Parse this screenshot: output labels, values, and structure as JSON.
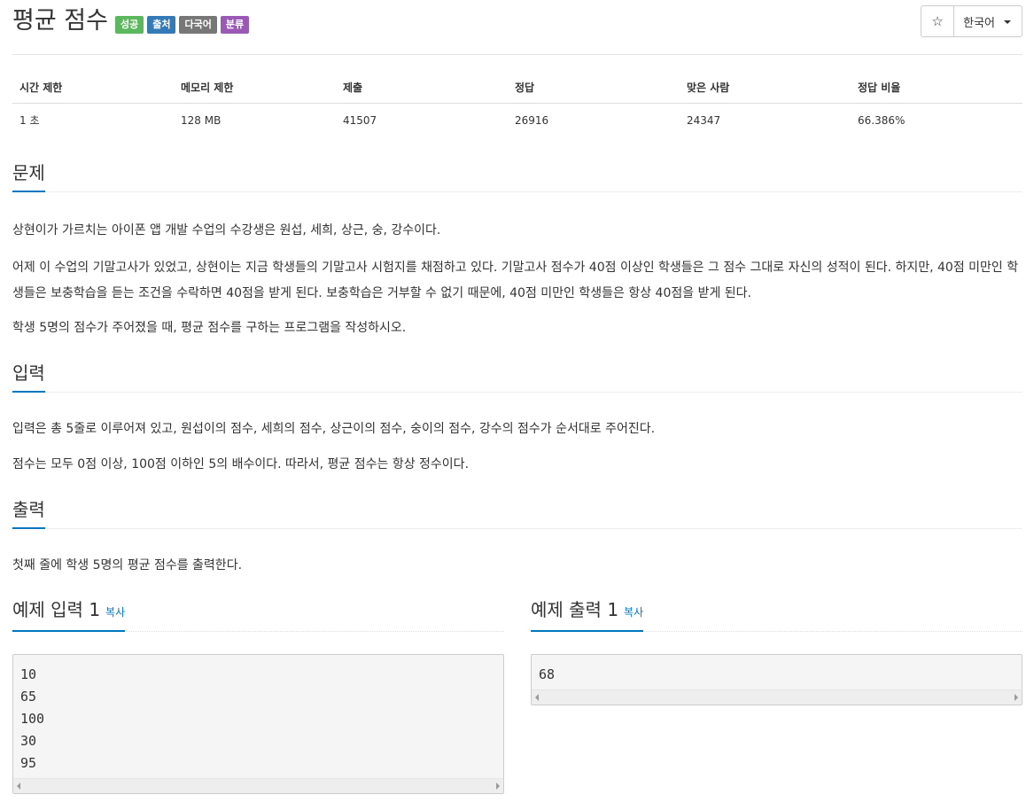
{
  "header": {
    "title": "평균 점수",
    "badges": [
      {
        "label": "성공",
        "color": "#5cb85c"
      },
      {
        "label": "출처",
        "color": "#337ab7"
      },
      {
        "label": "다국어",
        "color": "#777777"
      },
      {
        "label": "분류",
        "color": "#9b59b6"
      }
    ],
    "star_icon": "☆",
    "language": "한국어"
  },
  "stats": {
    "headers": [
      "시간 제한",
      "메모리 제한",
      "제출",
      "정답",
      "맞은 사람",
      "정답 비율"
    ],
    "values": [
      "1 초",
      "128 MB",
      "41507",
      "26916",
      "24347",
      "66.386%"
    ]
  },
  "problem": {
    "heading": "문제",
    "paragraphs": [
      "상현이가 가르치는 아이폰 앱 개발 수업의 수강생은 원섭, 세희, 상근, 숭, 강수이다.",
      "어제 이 수업의 기말고사가 있었고, 상현이는 지금 학생들의 기말고사 시험지를 채점하고 있다. 기말고사 점수가 40점 이상인 학생들은 그 점수 그대로 자신의 성적이 된다. 하지만, 40점 미만인 학생들은 보충학습을 듣는 조건을 수락하면 40점을 받게 된다. 보충학습은 거부할 수 없기 때문에, 40점 미만인 학생들은 항상 40점을 받게 된다.",
      "학생 5명의 점수가 주어졌을 때, 평균 점수를 구하는 프로그램을 작성하시오."
    ]
  },
  "input": {
    "heading": "입력",
    "paragraphs": [
      "입력은 총 5줄로 이루어져 있고, 원섭이의 점수, 세희의 점수, 상근이의 점수, 숭이의 점수, 강수의 점수가 순서대로 주어진다.",
      "점수는 모두 0점 이상, 100점 이하인 5의 배수이다. 따라서, 평균 점수는 항상 정수이다."
    ]
  },
  "output": {
    "heading": "출력",
    "paragraphs": [
      "첫째 줄에 학생 5명의 평균 점수를 출력한다."
    ]
  },
  "sample_input": {
    "heading": "예제 입력 1",
    "copy_label": "복사",
    "content": "10\n65\n100\n30\n95"
  },
  "sample_output": {
    "heading": "예제 출력 1",
    "copy_label": "복사",
    "content": "68"
  }
}
